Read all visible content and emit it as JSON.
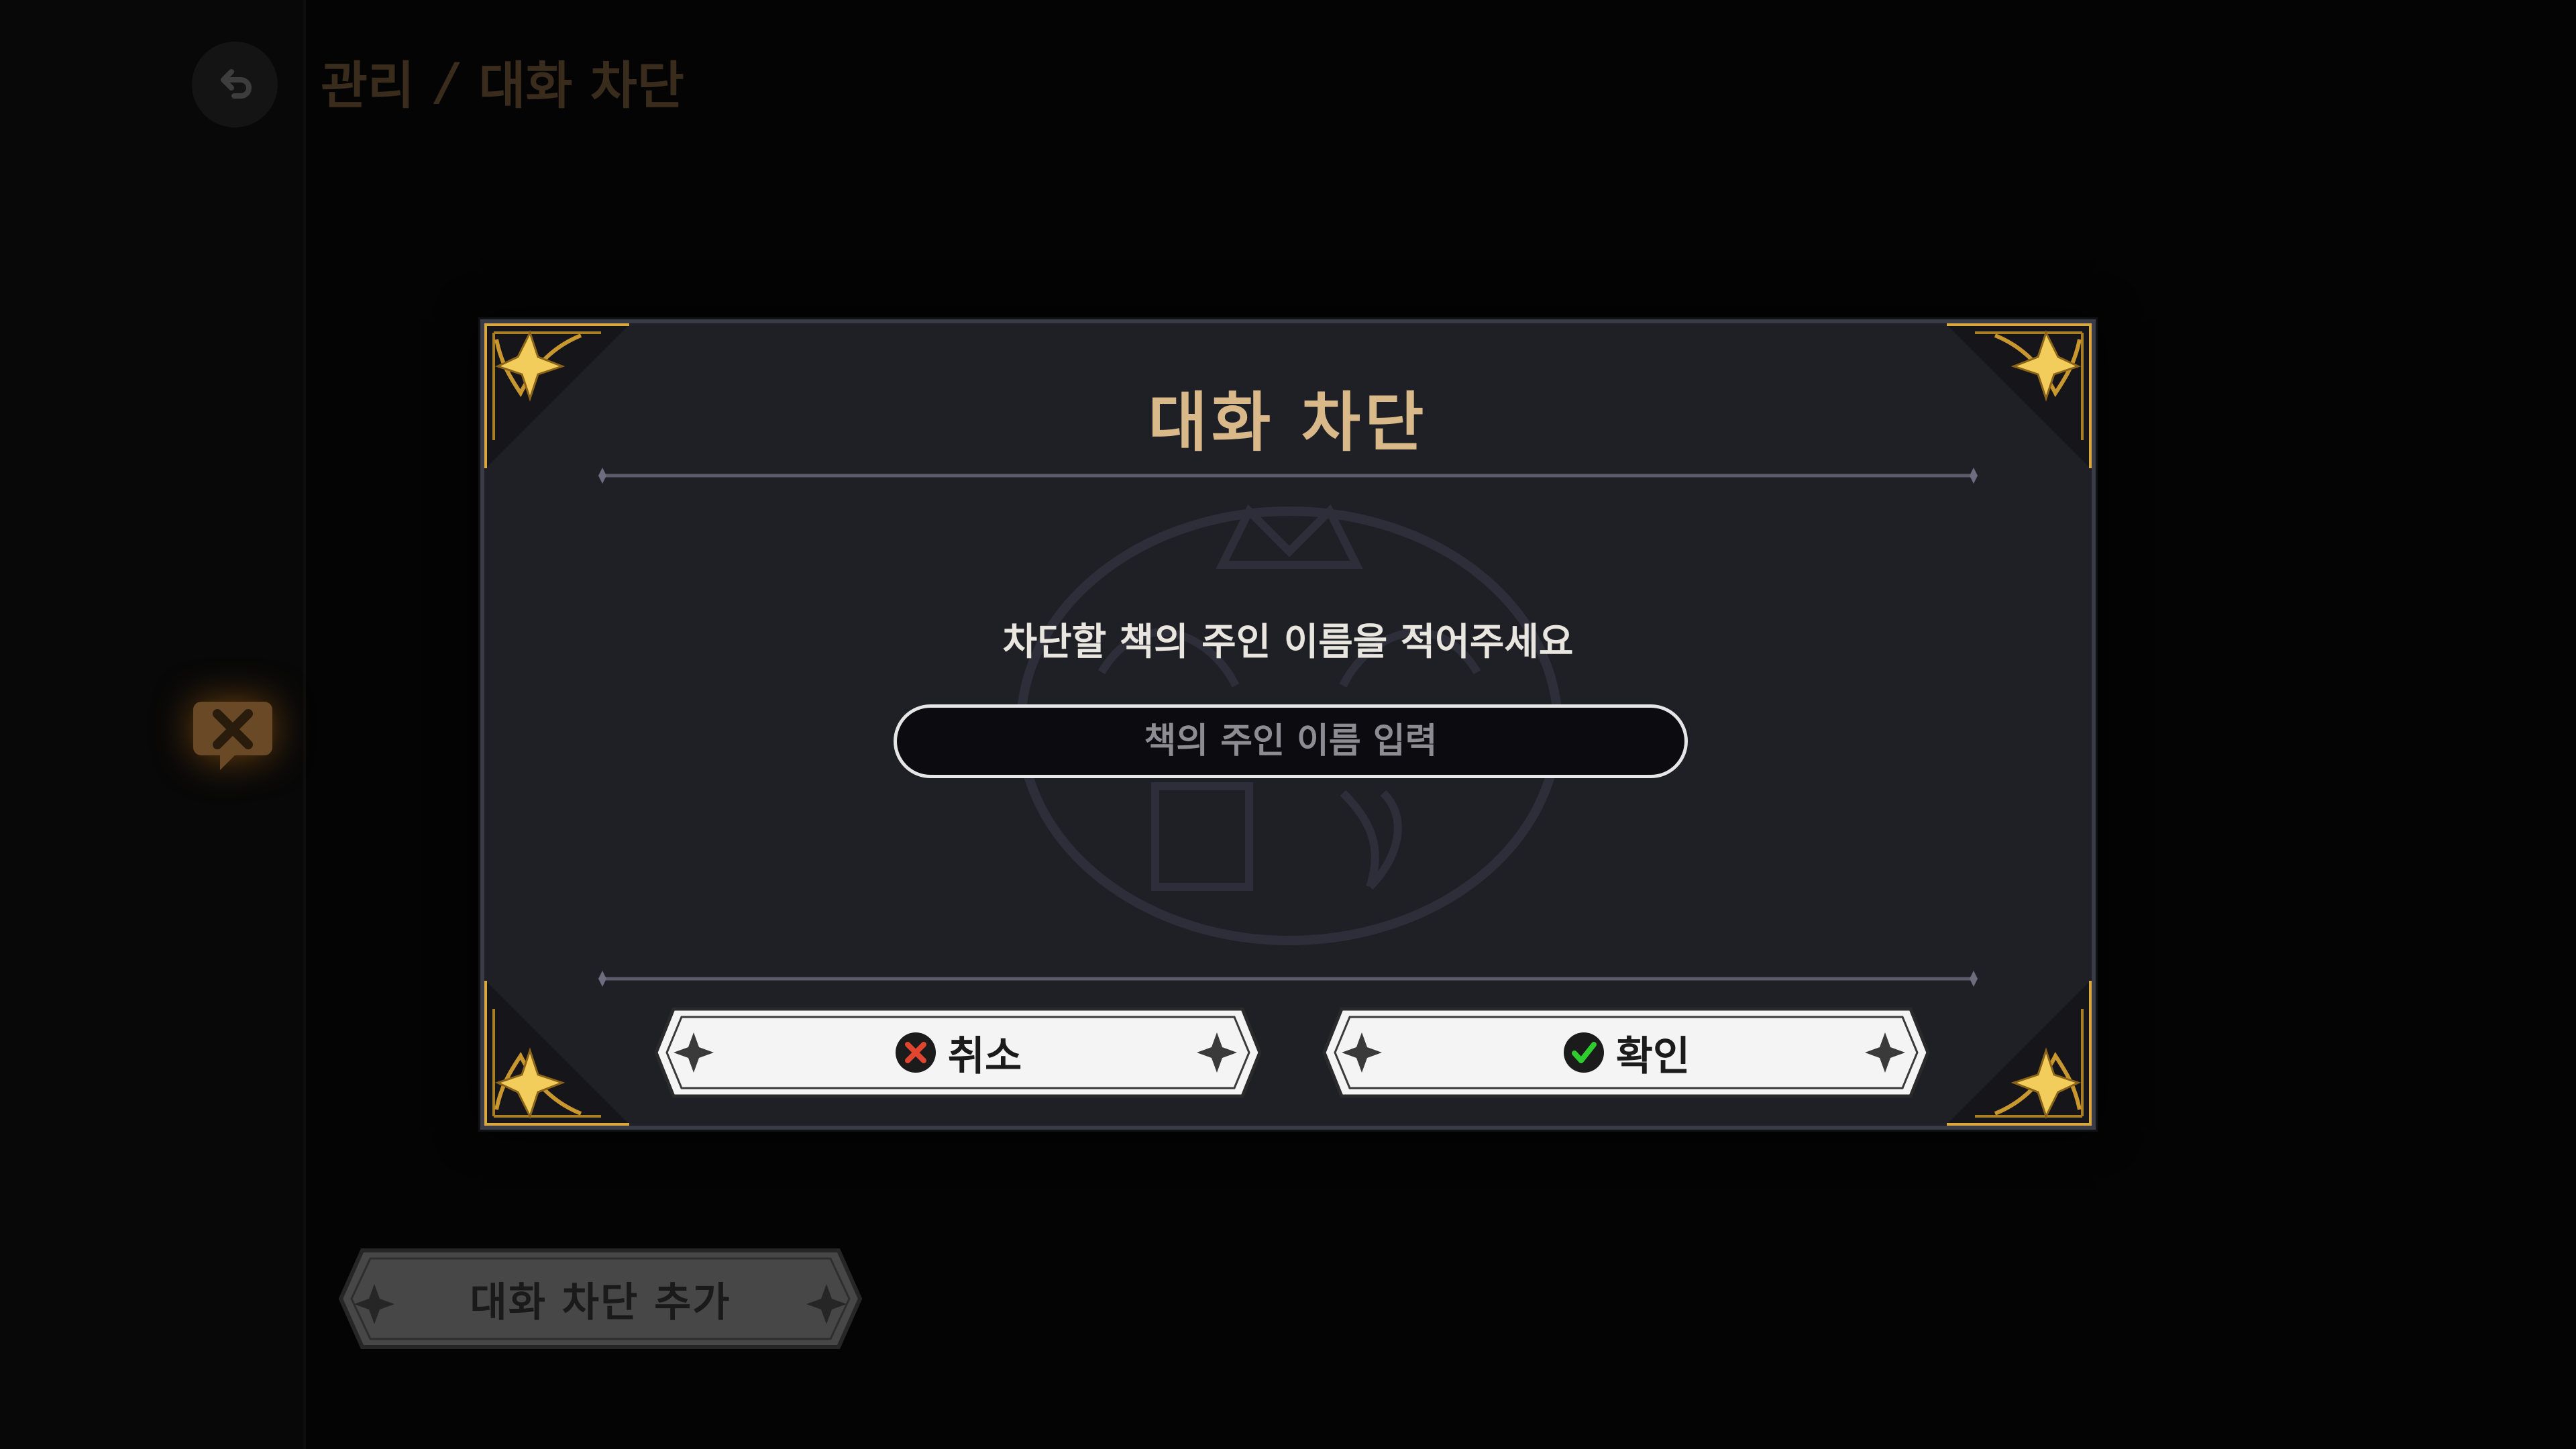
{
  "header": {
    "breadcrumb_parent": "관리",
    "breadcrumb_separator": "/",
    "breadcrumb_current": "대화 차단"
  },
  "footer": {
    "add_block_label": "대화 차단 추가"
  },
  "dialog": {
    "title": "대화 차단",
    "prompt": "차단할 책의 주인 이름을 적어주세요",
    "input_value": "",
    "input_placeholder": "책의 주인 이름 입력",
    "cancel_label": "취소",
    "confirm_label": "확인"
  },
  "icons": {
    "back": "back-arrow-icon",
    "side": "chat-block-icon",
    "cancel": "x-circle-icon",
    "confirm": "check-circle-icon"
  },
  "colors": {
    "title_gold": "#d9b98a",
    "corner_gold": "#d8a83c",
    "modal_bg": "#1f1f26",
    "cancel_red": "#e0452f",
    "confirm_green": "#2ecc2e"
  }
}
